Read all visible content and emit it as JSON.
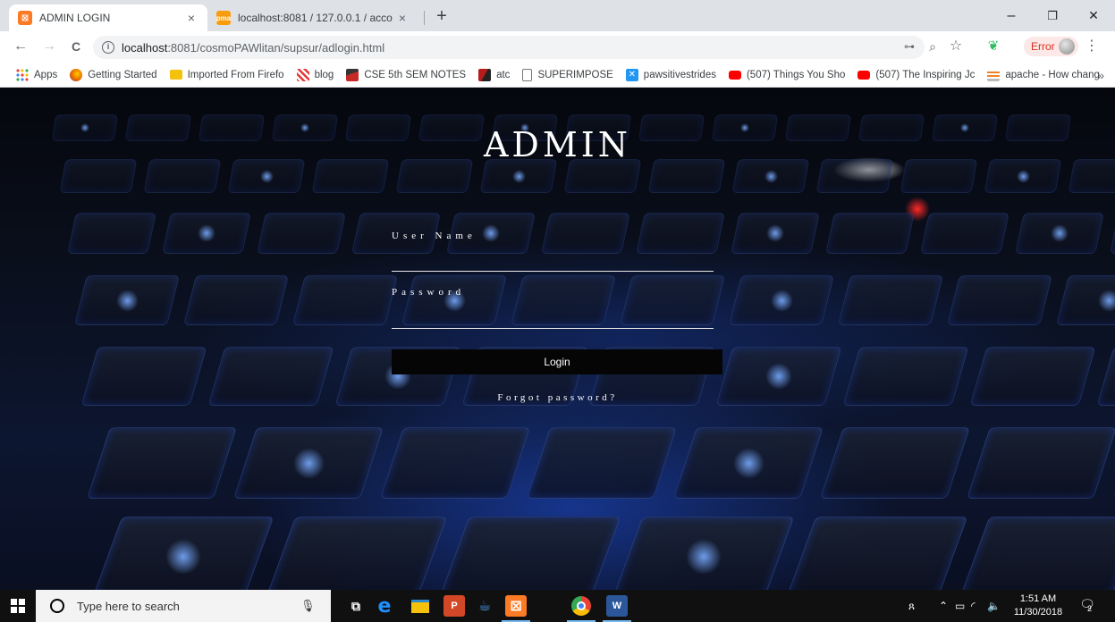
{
  "browser": {
    "tabs": [
      {
        "title": "ADMIN LOGIN",
        "favicon": "xampp-icon",
        "favicon_color": "#fb7a24",
        "active": true
      },
      {
        "title": "localhost:8081 / 127.0.0.1 / acco",
        "favicon": "phpmyadmin-icon",
        "favicon_color": "#f89c0e",
        "active": false
      }
    ],
    "tab_close": "×",
    "new_tab": "+",
    "window_controls": {
      "minimize": "–",
      "maximize": "❐",
      "close": "✕"
    },
    "toolbar": {
      "back": "←",
      "forward": "→",
      "reload": "C",
      "url_host": "localhost",
      "url_rest": ":8081/cosmoPAWlitan/supsur/adlogin.html",
      "key_icon": "🔑",
      "zoom_icon": "⊕",
      "star_icon": "☆",
      "evernote_icon": "evernote",
      "error_label": "Error",
      "menu": "⋮"
    },
    "bookmarks": [
      {
        "label": "Apps",
        "icon": "apps-grid-icon",
        "color": "#4285f4"
      },
      {
        "label": "Getting Started",
        "icon": "firefox-icon",
        "color": "#e66000"
      },
      {
        "label": "Imported From Firefo",
        "icon": "folder-icon",
        "color": "#f4c20d"
      },
      {
        "label": "blog",
        "icon": "blog-icon",
        "color": "#e53935"
      },
      {
        "label": "CSE 5th SEM NOTES",
        "icon": "graduation-cap-icon",
        "color": "#c62828"
      },
      {
        "label": "atc",
        "icon": "atc-icon",
        "color": "#b71c1c"
      },
      {
        "label": "SUPERIMPOSE",
        "icon": "page-icon",
        "color": "#9e9e9e"
      },
      {
        "label": "pawsitivestrides",
        "icon": "x-icon",
        "color": "#2196f3"
      },
      {
        "label": "(507) Things You Sho",
        "icon": "youtube-icon",
        "color": "#ff0000"
      },
      {
        "label": "(507) The Inspiring Jc",
        "icon": "youtube-icon",
        "color": "#ff0000"
      },
      {
        "label": "apache - How chang",
        "icon": "stackoverflow-icon",
        "color": "#f48024"
      }
    ],
    "bookmarks_more": "»"
  },
  "login": {
    "title": "ADMIN",
    "username_label": "User Name",
    "password_label": "Password",
    "button_label": "Login",
    "forgot_label": "Forgot password?"
  },
  "taskbar": {
    "search_placeholder": "Type here to search",
    "apps": [
      {
        "name": "task-view",
        "label": "⧉"
      },
      {
        "name": "edge",
        "label": "e",
        "color": "#1e90ff"
      },
      {
        "name": "file-explorer",
        "label": "▬",
        "color": "#f4c20d"
      },
      {
        "name": "powerpoint",
        "label": "P",
        "color": "#d24726"
      },
      {
        "name": "netbeans",
        "label": "☕",
        "color": "#1b6ac9"
      },
      {
        "name": "xampp",
        "label": "⊠",
        "color": "#fb7a24"
      },
      {
        "name": "chrome",
        "label": "●",
        "color": "#34a853"
      },
      {
        "name": "word",
        "label": "W",
        "color": "#2b579a"
      }
    ],
    "time": "1:51 AM",
    "date": "11/30/2018",
    "notification_count": "2"
  },
  "colors": {
    "page_bg": "#0a0f1c",
    "key_glow": "#2c5cff",
    "login_button_bg": "#050505",
    "text": "#ffffff"
  }
}
